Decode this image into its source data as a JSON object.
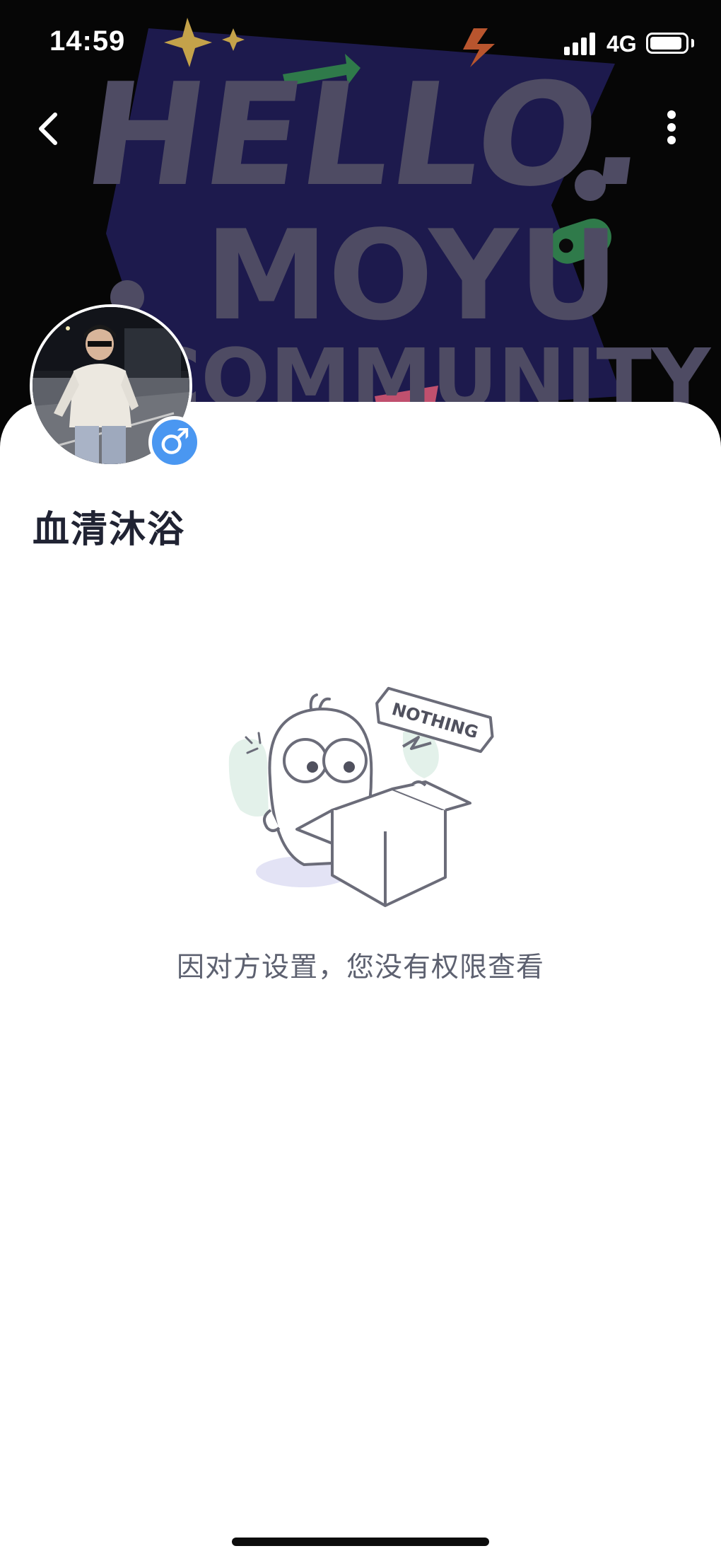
{
  "status_bar": {
    "time": "14:59",
    "network": "4G",
    "battery_level": 0.9
  },
  "banner": {
    "text_line1": "HELLO.",
    "text_line2": "MOYU",
    "text_line3": "COMMUNITY",
    "background_color": "#060606",
    "art_color": "#4e4b63",
    "shape_color": "#1d1a4d"
  },
  "nav": {
    "back_icon": "chevron-left-icon",
    "more_icon": "more-vertical-icon"
  },
  "profile": {
    "username": "血清沐浴",
    "gender": "male",
    "gender_symbol": "♂",
    "gender_color": "#4a97f1"
  },
  "empty_state": {
    "illustration_text": "NOTHING",
    "message": "因对方设置，您没有权限查看"
  }
}
